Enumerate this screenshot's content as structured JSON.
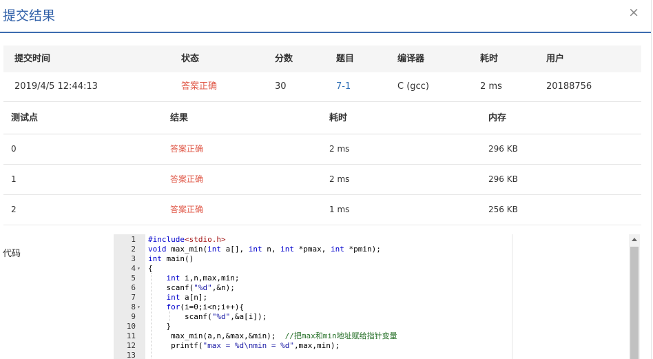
{
  "dialog": {
    "title": "提交结果",
    "close_symbol": "×"
  },
  "summary": {
    "headers": [
      "提交时间",
      "状态",
      "分数",
      "题目",
      "编译器",
      "耗时",
      "用户"
    ],
    "row": {
      "time": "2019/4/5 12:44:13",
      "status": "答案正确",
      "score": "30",
      "problem": "7-1",
      "compiler": "C (gcc)",
      "duration": "2 ms",
      "user": "20188756"
    },
    "colors": {
      "status": "#e05a4a",
      "problem_link": "#2f6fb6"
    }
  },
  "testcases": {
    "headers": [
      "测试点",
      "结果",
      "耗时",
      "内存"
    ],
    "rows": [
      {
        "id": "0",
        "result": "答案正确",
        "time": "2 ms",
        "memory": "296 KB"
      },
      {
        "id": "1",
        "result": "答案正确",
        "time": "2 ms",
        "memory": "296 KB"
      },
      {
        "id": "2",
        "result": "答案正确",
        "time": "1 ms",
        "memory": "256 KB"
      }
    ]
  },
  "code": {
    "label": "代码",
    "lines": [
      "#include<stdio.h>",
      "void max_min(int a[], int n, int *pmax, int *pmin);",
      "int main()",
      "{",
      "    int i,n,max,min;",
      "    scanf(\"%d\",&n);",
      "    int a[n];",
      "    for(i=0;i<n;i++){",
      "        scanf(\"%d\",&a[i]);",
      "    }",
      "     max_min(a,n,&max,&min);  //把max和min地址赋给指针变量",
      "     printf(\"max = %d\\nmin = %d\",max,min);",
      ""
    ]
  }
}
